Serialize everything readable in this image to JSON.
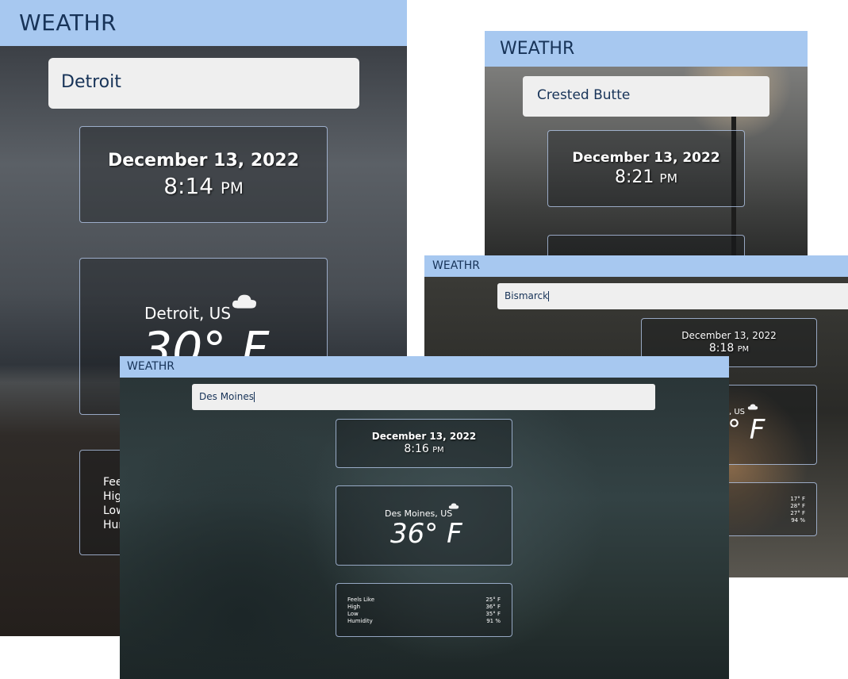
{
  "app_name": "WEATHR",
  "icons": {
    "weather": "cloud-icon"
  },
  "colors": {
    "header": "#a7c8f0",
    "header_text": "#173358",
    "search_bg": "#efefef",
    "card_border": "#bed2f5"
  },
  "screens": {
    "detroit": {
      "search_value": "Detroit",
      "date": "December 13, 2022",
      "time": "8:14",
      "ampm": "PM",
      "location": "Detroit, US",
      "temperature": "30° F",
      "stats": [
        "Fee",
        "Hig",
        "Low",
        "Hur"
      ]
    },
    "crested_butte": {
      "search_value": "Crested Butte",
      "date": "December 13, 2022",
      "time": "8:21",
      "ampm": "PM"
    },
    "bismarck": {
      "search_value": "Bismarck",
      "date": "December 13, 2022",
      "time": "8:18",
      "ampm": "PM",
      "location_partial": ", US",
      "temperature_partial": "° F",
      "stat_values": [
        "17° F",
        "28° F",
        "27° F",
        "94 %"
      ]
    },
    "des_moines": {
      "search_value": "Des Moines",
      "date": "December 13, 2022",
      "time": "8:16",
      "ampm": "PM",
      "location": "Des Moines, US",
      "temperature": "36° F",
      "stats": [
        {
          "label": "Feels Like",
          "value": "25° F"
        },
        {
          "label": "High",
          "value": "36° F"
        },
        {
          "label": "Low",
          "value": "35° F"
        },
        {
          "label": "Humidity",
          "value": "91 %"
        }
      ]
    }
  }
}
